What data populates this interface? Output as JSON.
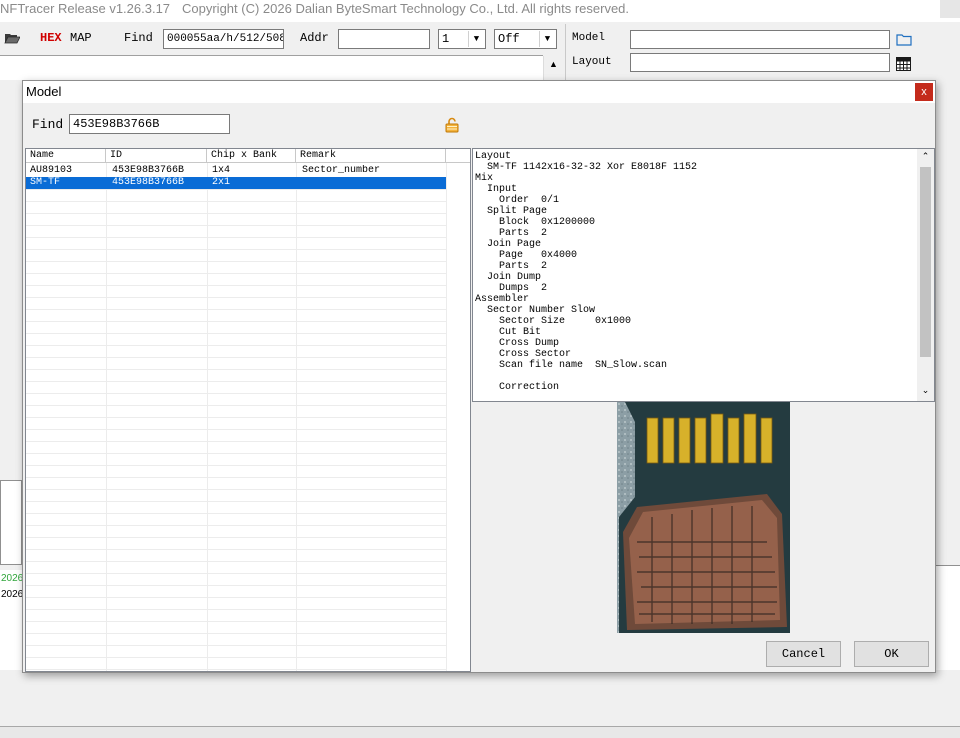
{
  "app": {
    "title": "NFTracer Release v1.26.3.17",
    "copyright": "Copyright (C) 2026 Dalian ByteSmart Technology Co., Ltd. All rights reserved."
  },
  "toolbar": {
    "hex_label": "HEX",
    "map_label": "MAP",
    "find_label": "Find",
    "find_value": "000055aa/h/512/508",
    "addr_label": "Addr",
    "addr_value": "",
    "combo1_value": "1",
    "combo2_value": "Off"
  },
  "right_panel": {
    "model_label": "Model",
    "layout_label": "Layout",
    "model_value": "",
    "layout_value": ""
  },
  "log": {
    "line1": "2026",
    "line2": "2026"
  },
  "dialog": {
    "title": "Model",
    "close_glyph": "x",
    "find_label": "Find",
    "find_value": "453E98B3766B",
    "columns": [
      "Name",
      "ID",
      "Chip x Bank",
      "Remark"
    ],
    "rows": [
      {
        "name": "AU89103",
        "id": "453E98B3766B",
        "chip_bank": "1x4",
        "remark": "Sector_number",
        "selected": false
      },
      {
        "name": "SM-TF",
        "id": "453E98B3766B",
        "chip_bank": "2x1",
        "remark": "",
        "selected": true
      }
    ],
    "layout_text": "Layout\n  SM-TF 1142x16-32-32 Xor E8018F 1152\nMix\n  Input\n    Order  0/1\n  Split Page\n    Block  0x1200000\n    Parts  2\n  Join Page\n    Page   0x4000\n    Parts  2\n  Join Dump\n    Dumps  2\nAssembler\n  Sector Number Slow\n    Sector Size     0x1000\n    Cut Bit\n    Cross Dump\n    Cross Sector\n    Scan file name  SN_Slow.scan\n\n    Correction",
    "cancel_label": "Cancel",
    "ok_label": "OK"
  },
  "colors": {
    "selection": "#0a6cd6",
    "hex_red": "#d00000",
    "close_red": "#c42b1c",
    "log_green": "#2fa53a"
  }
}
